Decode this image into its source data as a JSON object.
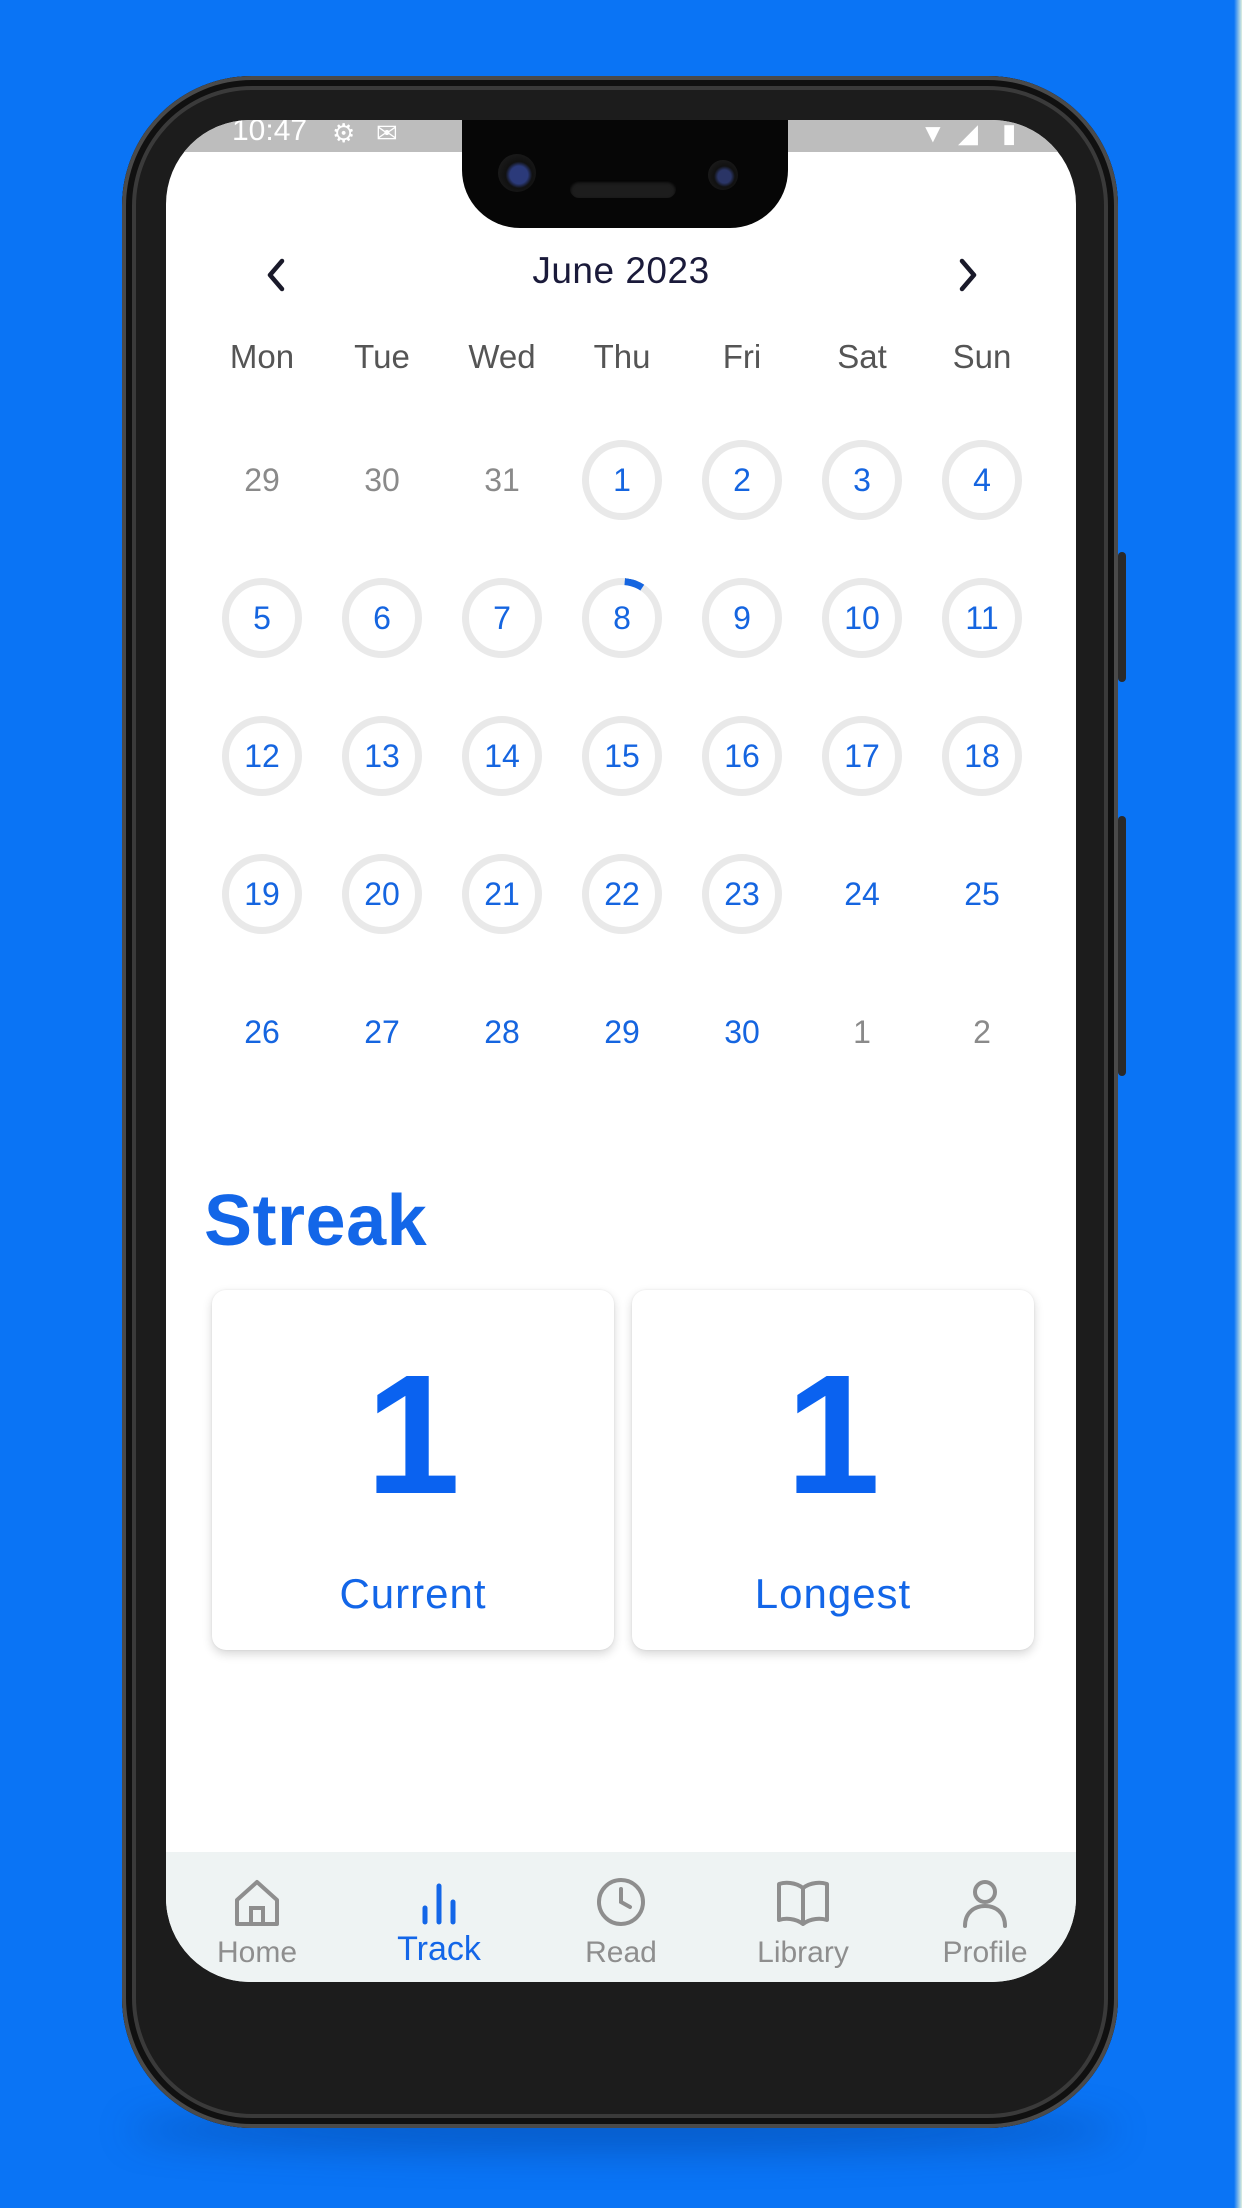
{
  "status_bar": {
    "time": "10:47"
  },
  "calendar": {
    "month_label": "June 2023",
    "weekdays": [
      "Mon",
      "Tue",
      "Wed",
      "Thu",
      "Fri",
      "Sat",
      "Sun"
    ],
    "weeks": [
      [
        {
          "d": "29",
          "style": "muted"
        },
        {
          "d": "30",
          "style": "muted"
        },
        {
          "d": "31",
          "style": "muted"
        },
        {
          "d": "1",
          "style": "ring"
        },
        {
          "d": "2",
          "style": "ring"
        },
        {
          "d": "3",
          "style": "ring"
        },
        {
          "d": "4",
          "style": "ring"
        }
      ],
      [
        {
          "d": "5",
          "style": "ring"
        },
        {
          "d": "6",
          "style": "ring"
        },
        {
          "d": "7",
          "style": "ring"
        },
        {
          "d": "8",
          "style": "progress"
        },
        {
          "d": "9",
          "style": "ring"
        },
        {
          "d": "10",
          "style": "ring"
        },
        {
          "d": "11",
          "style": "ring"
        }
      ],
      [
        {
          "d": "12",
          "style": "ring"
        },
        {
          "d": "13",
          "style": "ring"
        },
        {
          "d": "14",
          "style": "ring"
        },
        {
          "d": "15",
          "style": "ring"
        },
        {
          "d": "16",
          "style": "ring"
        },
        {
          "d": "17",
          "style": "ring"
        },
        {
          "d": "18",
          "style": "ring"
        }
      ],
      [
        {
          "d": "19",
          "style": "ring"
        },
        {
          "d": "20",
          "style": "ring"
        },
        {
          "d": "21",
          "style": "ring"
        },
        {
          "d": "22",
          "style": "ring"
        },
        {
          "d": "23",
          "style": "ring"
        },
        {
          "d": "24",
          "style": "plain"
        },
        {
          "d": "25",
          "style": "plain"
        }
      ],
      [
        {
          "d": "26",
          "style": "plain"
        },
        {
          "d": "27",
          "style": "plain"
        },
        {
          "d": "28",
          "style": "plain"
        },
        {
          "d": "29",
          "style": "plain"
        },
        {
          "d": "30",
          "style": "plain"
        },
        {
          "d": "1",
          "style": "muted"
        },
        {
          "d": "2",
          "style": "muted"
        }
      ]
    ]
  },
  "streak": {
    "title": "Streak",
    "current_value": "1",
    "current_label": "Current",
    "longest_value": "1",
    "longest_label": "Longest"
  },
  "bottom_nav": {
    "items": [
      {
        "label": "Home",
        "icon": "home-icon"
      },
      {
        "label": "Track",
        "icon": "bar-chart-icon",
        "active": true
      },
      {
        "label": "Read",
        "icon": "clock-icon"
      },
      {
        "label": "Library",
        "icon": "book-icon"
      },
      {
        "label": "Profile",
        "icon": "person-icon"
      }
    ]
  },
  "colors": {
    "background": "#0a74f5",
    "accent": "#1366e8",
    "muted_text": "#8a8a8a",
    "ring": "#e9e9e9",
    "nav_bg": "#eef3f3"
  }
}
